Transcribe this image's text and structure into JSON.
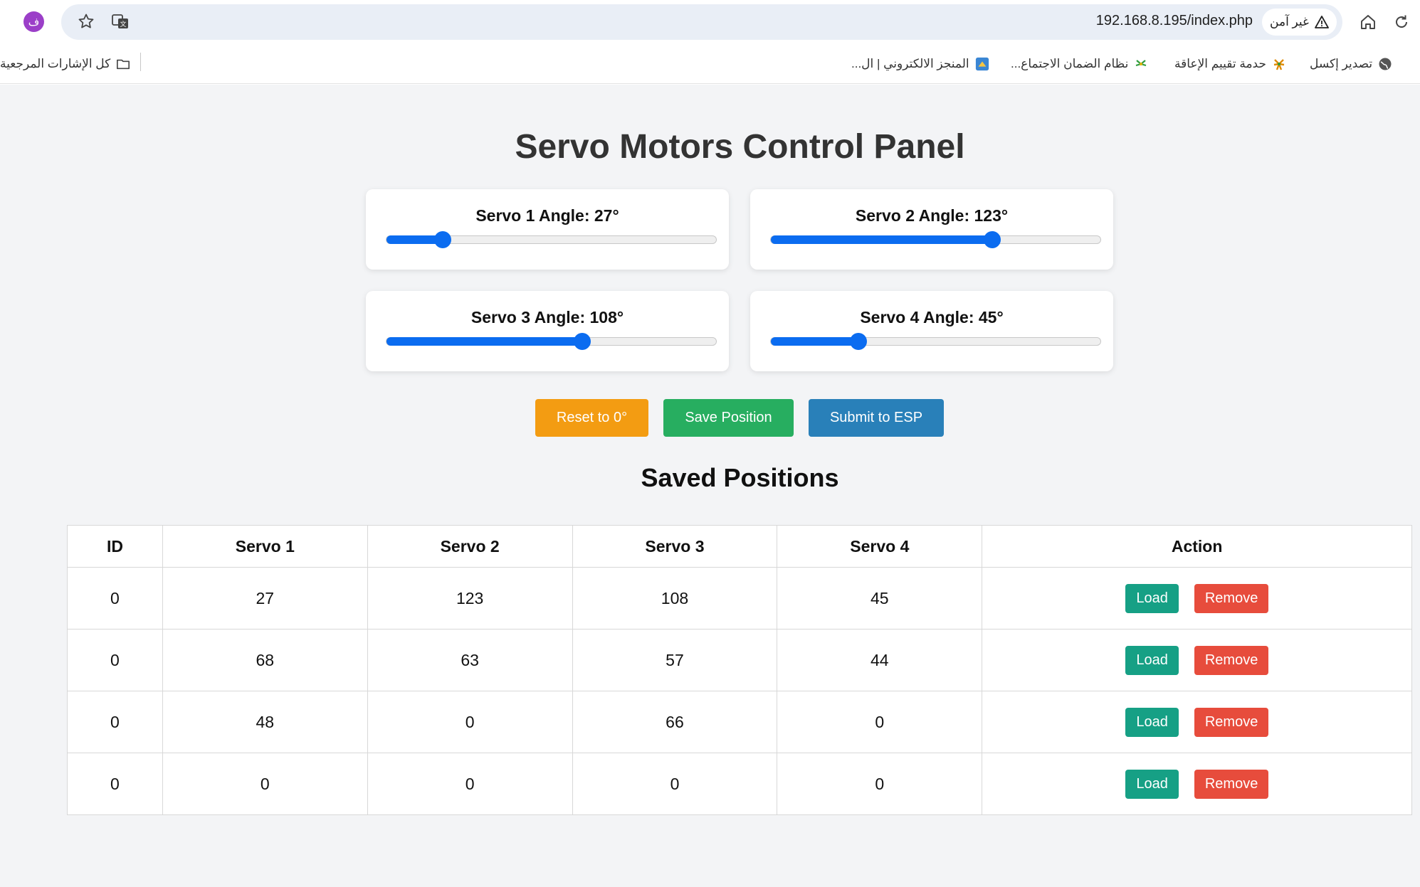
{
  "browser": {
    "profile_initial": "ف",
    "url": "192.168.8.195/index.php",
    "security_label": "غير آمن",
    "bookmarks": [
      {
        "label": "تصدير إكسل",
        "icon": "globe-icon"
      },
      {
        "label": "حدمة تقييم الإعاقة",
        "icon": "palm-icon"
      },
      {
        "label": "نظام الضمان الاجتماع...",
        "icon": "palm-icon"
      },
      {
        "label": "المنجز الالكتروني | ال...",
        "icon": "app-icon"
      },
      {
        "label": "كل الإشارات المرجعية",
        "icon": "folder-icon"
      }
    ]
  },
  "page": {
    "title": "Servo Motors Control Panel",
    "saved_title": "Saved Positions"
  },
  "servos": [
    {
      "label": "Servo 1 Angle: 27°",
      "angle": 27
    },
    {
      "label": "Servo 2 Angle: 123°",
      "angle": 123
    },
    {
      "label": "Servo 3 Angle: 108°",
      "angle": 108
    },
    {
      "label": "Servo 4 Angle: 45°",
      "angle": 45
    }
  ],
  "slider_max": 180,
  "buttons": {
    "reset": "Reset to 0°",
    "save": "Save Position",
    "submit": "Submit to ESP"
  },
  "table": {
    "headers": [
      "ID",
      "Servo 1",
      "Servo 2",
      "Servo 3",
      "Servo 4",
      "Action"
    ],
    "rows": [
      [
        "0",
        "27",
        "123",
        "108",
        "45"
      ],
      [
        "0",
        "68",
        "63",
        "57",
        "44"
      ],
      [
        "0",
        "48",
        "0",
        "66",
        "0"
      ],
      [
        "0",
        "0",
        "0",
        "0",
        "0"
      ]
    ],
    "load_label": "Load",
    "remove_label": "Remove"
  },
  "colors": {
    "slider_accent": "#0b6cf0",
    "reset": "#f39c12",
    "save": "#27ae60",
    "submit": "#2980b9",
    "load": "#16a085",
    "remove": "#e74c3c"
  }
}
